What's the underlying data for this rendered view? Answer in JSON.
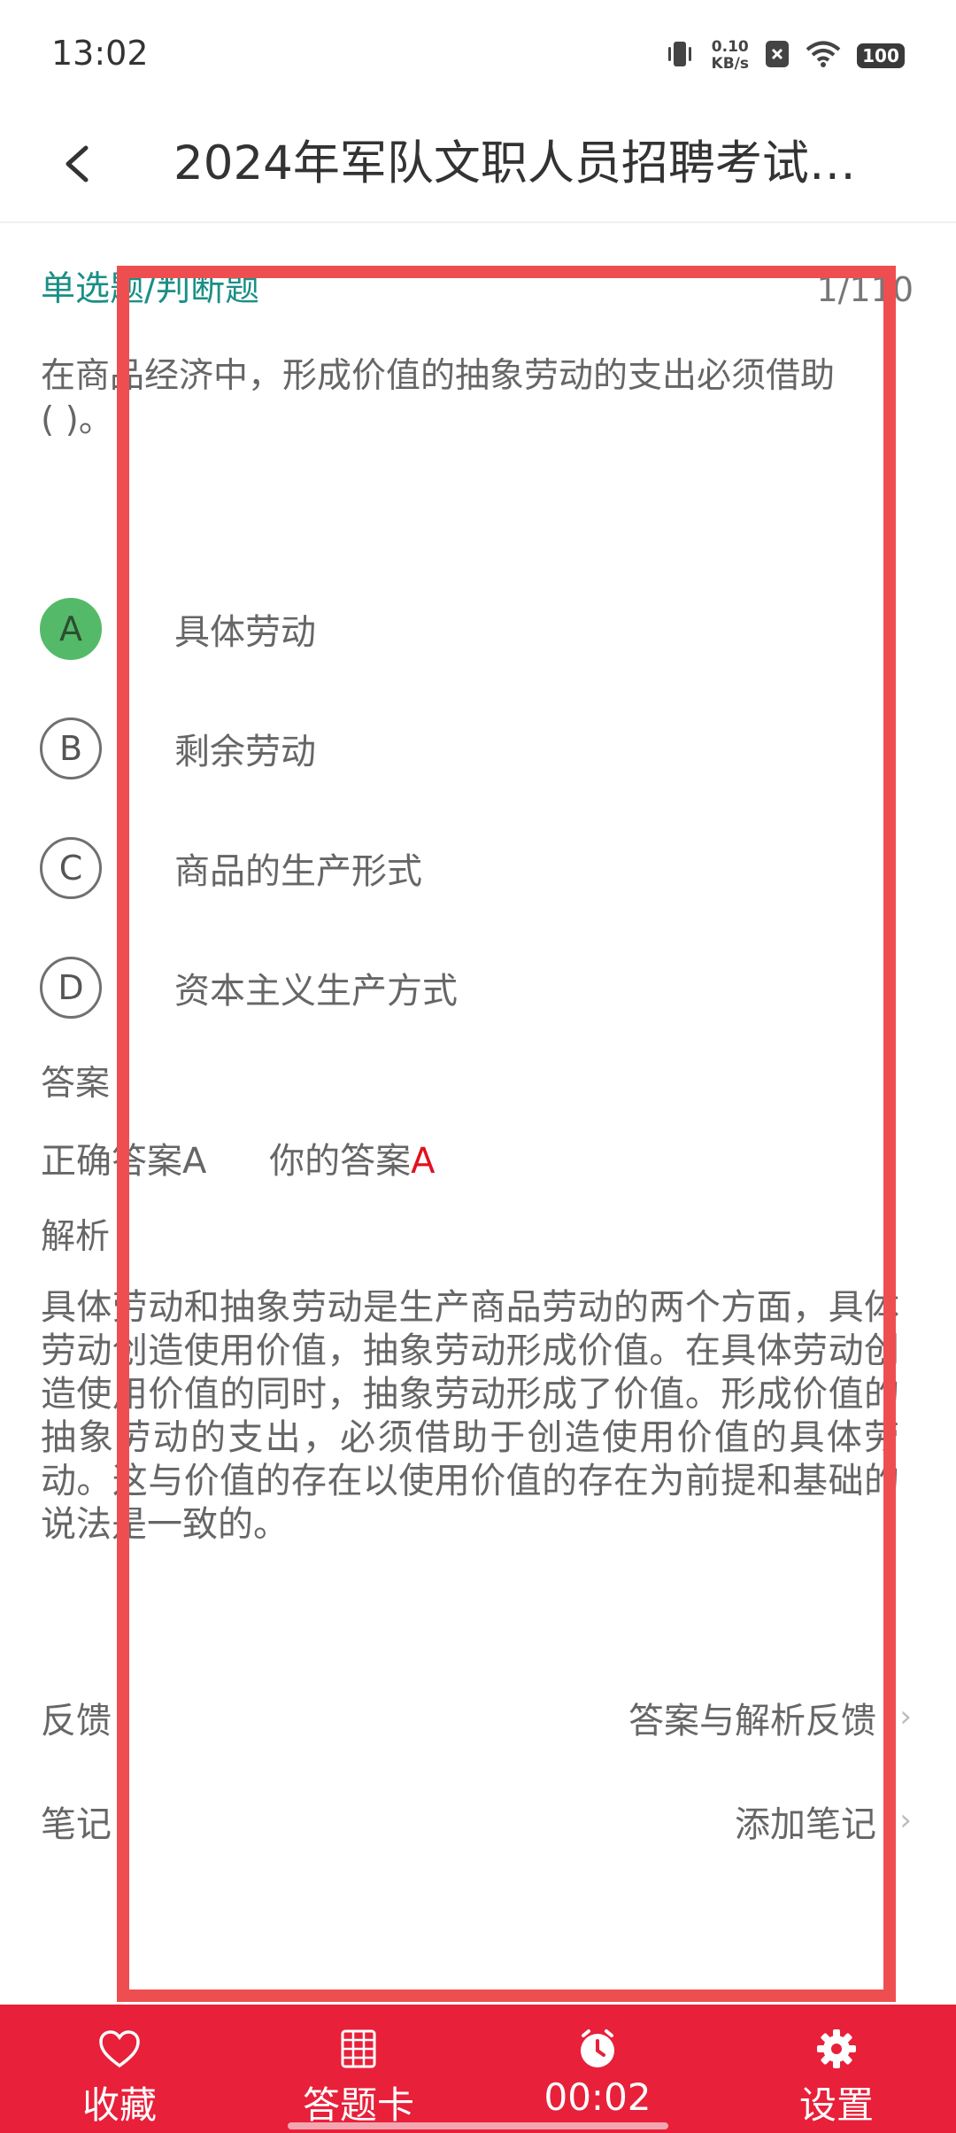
{
  "status_bar": {
    "time": "13:02",
    "net_speed_value": "0.10",
    "net_speed_unit": "KB/s",
    "battery": "100"
  },
  "header": {
    "title": "2024年军队文职人员招聘考试…"
  },
  "question": {
    "type_label": "单选题/判断题",
    "progress": "1/110",
    "text_line1": "在商品经济中，形成价值的抽象劳动的支出必须借助",
    "text_line2": "( )。",
    "options": [
      {
        "letter": "A",
        "text": "具体劳动",
        "selected": true
      },
      {
        "letter": "B",
        "text": "剩余劳动",
        "selected": false
      },
      {
        "letter": "C",
        "text": "商品的生产形式",
        "selected": false
      },
      {
        "letter": "D",
        "text": "资本主义生产方式",
        "selected": false
      }
    ]
  },
  "answer": {
    "section_label": "答案",
    "correct_label": "正确答案",
    "correct_value": "A",
    "yours_label": "你的答案",
    "yours_value": "A"
  },
  "analysis": {
    "section_label": "解析",
    "text": "具体劳动和抽象劳动是生产商品劳动的两个方面，具体劳动创造使用价值，抽象劳动形成价值。在具体劳动创造使用价值的同时，抽象劳动形成了价值。形成价值的抽象劳动的支出，必须借助于创造使用价值的具体劳动。这与价值的存在以使用价值的存在为前提和基础的说法是一致的。"
  },
  "feedback": {
    "label": "反馈",
    "value": "答案与解析反馈"
  },
  "notes": {
    "label": "笔记",
    "value": "添加笔记"
  },
  "bottom_nav": {
    "items": [
      {
        "label": "收藏",
        "icon": "heart-icon"
      },
      {
        "label": "答题卡",
        "icon": "grid-icon"
      },
      {
        "label": "00:02",
        "icon": "clock-icon"
      },
      {
        "label": "设置",
        "icon": "gear-icon"
      }
    ]
  },
  "colors": {
    "accent_teal": "#1a8f86",
    "correct_green": "#55b96a",
    "answer_red": "#e0121e",
    "nav_red": "#e8203a",
    "overlay_red": "#ef4e50"
  }
}
